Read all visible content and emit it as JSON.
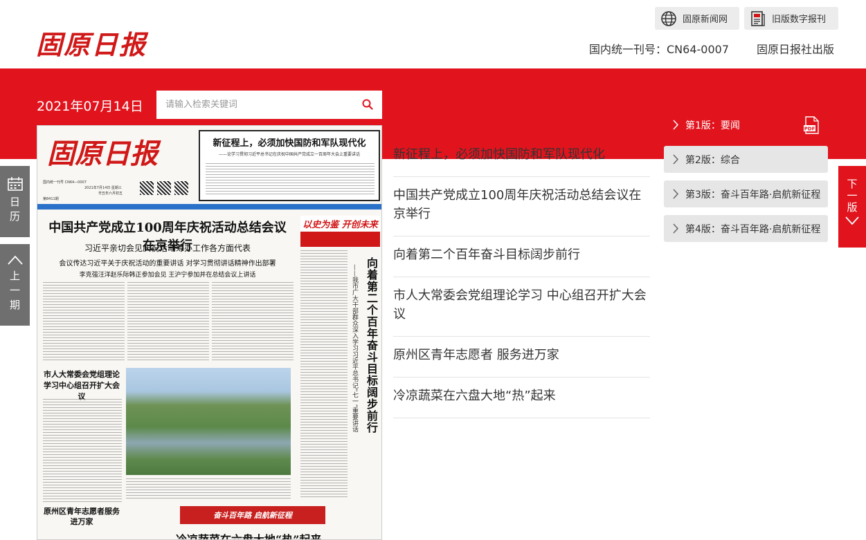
{
  "header": {
    "logo": "固原日报",
    "links": [
      {
        "label": "固原新闻网",
        "icon": "globe-icon"
      },
      {
        "label": "旧版数字报刊",
        "icon": "newspaper-icon"
      }
    ],
    "issn": "国内统一刊号：CN64-0007",
    "publisher": "固原日报社出版"
  },
  "date": "2021年07月14日",
  "search": {
    "placeholder": "请输入检索关键词",
    "icon": "search-icon"
  },
  "side_tabs": {
    "calendar": {
      "label": "日历",
      "icon": "calendar-icon"
    },
    "prev": {
      "label": "上一期",
      "icon": "chevron-up-icon"
    },
    "next": {
      "label": "下一版",
      "icon": "chevron-down-icon"
    }
  },
  "current_page": "第1版：要闻",
  "articles": [
    "新征程上，必须加快国防和军队现代化",
    "中国共产党成立100周年庆祝活动总结会议在京举行",
    "向着第二个百年奋斗目标阔步前行",
    "市人大常委会党组理论学习 中心组召开扩大会议",
    "原州区青年志愿者 服务进万家",
    "冷凉蔬菜在六盘大地“热”起来"
  ],
  "page_nav": [
    {
      "label": "第1版：要闻",
      "active": true,
      "icon": "pdf-icon"
    },
    {
      "label": "第2版：综合",
      "active": false
    },
    {
      "label": "第3版：奋斗百年路·启航新征程",
      "active": false
    },
    {
      "label": "第4版：奋斗百年路·启航新征程",
      "active": false
    }
  ],
  "paper": {
    "logo": "固原日报",
    "meta1": "国内统一刊号 CN64—0007",
    "meta2": "2021年7月14日 星期三",
    "meta3": "辛丑年六月初五",
    "meta4": "第8411期",
    "headbox_title": "新征程上，必须加快国防和军队现代化",
    "headbox_sub": "——论学习贯彻习近平总书记在庆祝中国共产党成立一百周年大会上重要讲话",
    "main_title": "中国共产党成立100周年庆祝活动总结会议在京举行",
    "sub1": "习近平亲切会见庆祝活动筹办工作各方面代表",
    "sub2": "会议传达习近平关于庆祝活动的重要讲话 对学习贯彻讲话精神作出部署",
    "sub3": "李克强汪洋赵乐际韩正参加会见 王沪宁参加并在总结会议上讲话",
    "banner": "以史为鉴 开创未来",
    "vtitle": "向着第二个百年奋斗目标阔步前行",
    "vsub": "——我市广大干部群众深入学习习近平总书记“七一”重要讲话",
    "left_head": "市人大常委会党组理论学习中心组召开扩大会议",
    "left_head2": "原州区青年志愿者服务进万家",
    "bottom_banner": "奋斗百年路 启航新征程",
    "bottom_title": "冷凉蔬菜在六盘大地“热”起来"
  },
  "colors": {
    "brand_red": "#e1141e",
    "nav_gray": "#e6e6e6",
    "side_gray": "#6f6f6f"
  }
}
